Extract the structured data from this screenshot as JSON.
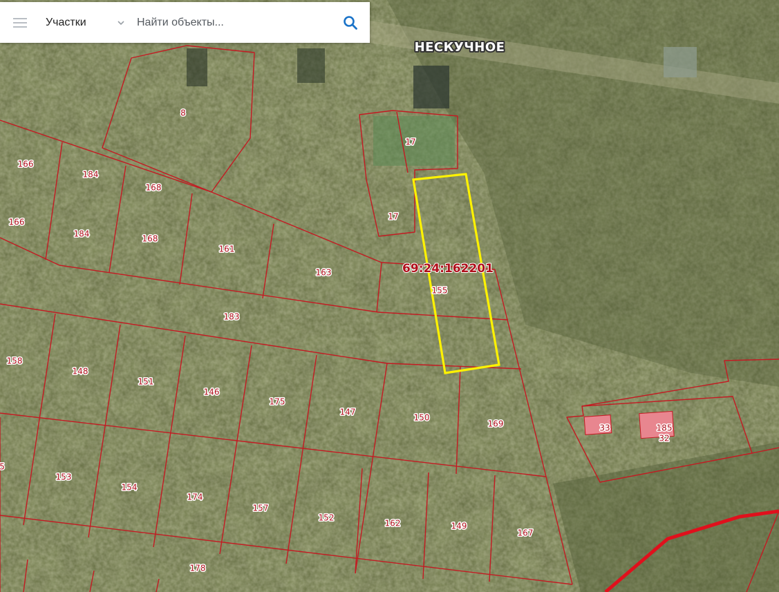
{
  "search": {
    "layer_label": "Участки",
    "placeholder": "Найти объекты..."
  },
  "map": {
    "place_name": "НЕСКУЧНОЕ",
    "selected_cadastral": "69:24:162201",
    "parcel_labels": [
      "8",
      "17",
      "17",
      "166",
      "184",
      "168",
      "166",
      "184",
      "168",
      "161",
      "163",
      "155",
      "183",
      "158",
      "148",
      "151",
      "146",
      "175",
      "147",
      "150",
      "169",
      "5",
      "153",
      "154",
      "174",
      "157",
      "152",
      "162",
      "149",
      "167",
      "178",
      "33",
      "185",
      "32"
    ],
    "colors": {
      "boundary": "#c41a22",
      "highlight": "#fff200",
      "building_fill": "#e8868f",
      "label_text": "#b0101c",
      "search_icon": "#1a73c8"
    }
  }
}
